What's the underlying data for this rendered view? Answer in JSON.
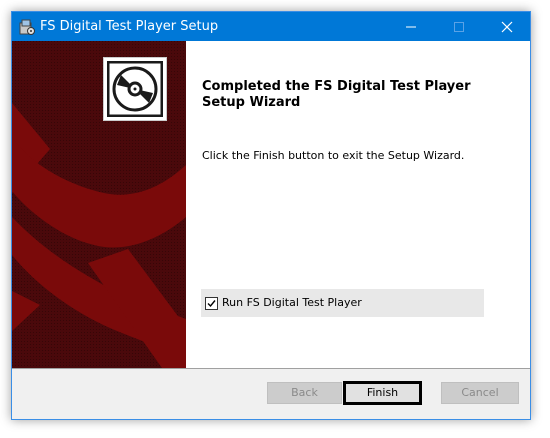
{
  "window": {
    "title": "FS Digital Test Player Setup",
    "app_icon": "installer-icon",
    "controls": {
      "minimize": "minimize-icon",
      "maximize": "maximize-icon",
      "close": "close-icon"
    }
  },
  "side_panel": {
    "logo_icon": "disc-icon",
    "background_color": "#4a090b",
    "accent_color": "#7a0a0a"
  },
  "content": {
    "heading": "Completed the FS Digital Test Player Setup Wizard",
    "body": "Click the Finish button to exit the Setup Wizard.",
    "run_checkbox": {
      "label": "Run FS Digital Test Player",
      "checked": true
    }
  },
  "footer": {
    "back_label": "Back",
    "finish_label": "Finish",
    "cancel_label": "Cancel"
  },
  "colors": {
    "titlebar": "#0078d7",
    "footer_bg": "#f0f0f0"
  }
}
